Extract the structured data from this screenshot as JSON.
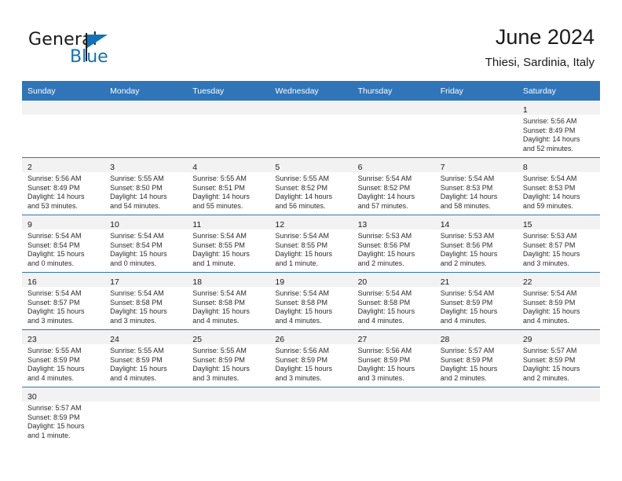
{
  "brand": {
    "name_top": "General",
    "name_bottom": "Blue",
    "flag_color": "#1072bb",
    "icon": "general-blue-logo"
  },
  "header": {
    "title": "June 2024",
    "subtitle": "Thiesi, Sardinia, Italy"
  },
  "theme": {
    "header_blue": "#3075b8",
    "daynum_strip": "#f2f2f2",
    "text": "#1a1a1a",
    "brand_blue": "#1072bb"
  },
  "calendar": {
    "weekday_headers": [
      "Sunday",
      "Monday",
      "Tuesday",
      "Wednesday",
      "Thursday",
      "Friday",
      "Saturday"
    ],
    "weeks": [
      [
        {
          "empty": true
        },
        {
          "empty": true
        },
        {
          "empty": true
        },
        {
          "empty": true
        },
        {
          "empty": true
        },
        {
          "empty": true
        },
        {
          "day": "1",
          "sunrise": "Sunrise: 5:56 AM",
          "sunset": "Sunset: 8:49 PM",
          "daylight1": "Daylight: 14 hours",
          "daylight2": "and 52 minutes."
        }
      ],
      [
        {
          "day": "2",
          "sunrise": "Sunrise: 5:56 AM",
          "sunset": "Sunset: 8:49 PM",
          "daylight1": "Daylight: 14 hours",
          "daylight2": "and 53 minutes."
        },
        {
          "day": "3",
          "sunrise": "Sunrise: 5:55 AM",
          "sunset": "Sunset: 8:50 PM",
          "daylight1": "Daylight: 14 hours",
          "daylight2": "and 54 minutes."
        },
        {
          "day": "4",
          "sunrise": "Sunrise: 5:55 AM",
          "sunset": "Sunset: 8:51 PM",
          "daylight1": "Daylight: 14 hours",
          "daylight2": "and 55 minutes."
        },
        {
          "day": "5",
          "sunrise": "Sunrise: 5:55 AM",
          "sunset": "Sunset: 8:52 PM",
          "daylight1": "Daylight: 14 hours",
          "daylight2": "and 56 minutes."
        },
        {
          "day": "6",
          "sunrise": "Sunrise: 5:54 AM",
          "sunset": "Sunset: 8:52 PM",
          "daylight1": "Daylight: 14 hours",
          "daylight2": "and 57 minutes."
        },
        {
          "day": "7",
          "sunrise": "Sunrise: 5:54 AM",
          "sunset": "Sunset: 8:53 PM",
          "daylight1": "Daylight: 14 hours",
          "daylight2": "and 58 minutes."
        },
        {
          "day": "8",
          "sunrise": "Sunrise: 5:54 AM",
          "sunset": "Sunset: 8:53 PM",
          "daylight1": "Daylight: 14 hours",
          "daylight2": "and 59 minutes."
        }
      ],
      [
        {
          "day": "9",
          "sunrise": "Sunrise: 5:54 AM",
          "sunset": "Sunset: 8:54 PM",
          "daylight1": "Daylight: 15 hours",
          "daylight2": "and 0 minutes."
        },
        {
          "day": "10",
          "sunrise": "Sunrise: 5:54 AM",
          "sunset": "Sunset: 8:54 PM",
          "daylight1": "Daylight: 15 hours",
          "daylight2": "and 0 minutes."
        },
        {
          "day": "11",
          "sunrise": "Sunrise: 5:54 AM",
          "sunset": "Sunset: 8:55 PM",
          "daylight1": "Daylight: 15 hours",
          "daylight2": "and 1 minute."
        },
        {
          "day": "12",
          "sunrise": "Sunrise: 5:54 AM",
          "sunset": "Sunset: 8:55 PM",
          "daylight1": "Daylight: 15 hours",
          "daylight2": "and 1 minute."
        },
        {
          "day": "13",
          "sunrise": "Sunrise: 5:53 AM",
          "sunset": "Sunset: 8:56 PM",
          "daylight1": "Daylight: 15 hours",
          "daylight2": "and 2 minutes."
        },
        {
          "day": "14",
          "sunrise": "Sunrise: 5:53 AM",
          "sunset": "Sunset: 8:56 PM",
          "daylight1": "Daylight: 15 hours",
          "daylight2": "and 2 minutes."
        },
        {
          "day": "15",
          "sunrise": "Sunrise: 5:53 AM",
          "sunset": "Sunset: 8:57 PM",
          "daylight1": "Daylight: 15 hours",
          "daylight2": "and 3 minutes."
        }
      ],
      [
        {
          "day": "16",
          "sunrise": "Sunrise: 5:54 AM",
          "sunset": "Sunset: 8:57 PM",
          "daylight1": "Daylight: 15 hours",
          "daylight2": "and 3 minutes."
        },
        {
          "day": "17",
          "sunrise": "Sunrise: 5:54 AM",
          "sunset": "Sunset: 8:58 PM",
          "daylight1": "Daylight: 15 hours",
          "daylight2": "and 3 minutes."
        },
        {
          "day": "18",
          "sunrise": "Sunrise: 5:54 AM",
          "sunset": "Sunset: 8:58 PM",
          "daylight1": "Daylight: 15 hours",
          "daylight2": "and 4 minutes."
        },
        {
          "day": "19",
          "sunrise": "Sunrise: 5:54 AM",
          "sunset": "Sunset: 8:58 PM",
          "daylight1": "Daylight: 15 hours",
          "daylight2": "and 4 minutes."
        },
        {
          "day": "20",
          "sunrise": "Sunrise: 5:54 AM",
          "sunset": "Sunset: 8:58 PM",
          "daylight1": "Daylight: 15 hours",
          "daylight2": "and 4 minutes."
        },
        {
          "day": "21",
          "sunrise": "Sunrise: 5:54 AM",
          "sunset": "Sunset: 8:59 PM",
          "daylight1": "Daylight: 15 hours",
          "daylight2": "and 4 minutes."
        },
        {
          "day": "22",
          "sunrise": "Sunrise: 5:54 AM",
          "sunset": "Sunset: 8:59 PM",
          "daylight1": "Daylight: 15 hours",
          "daylight2": "and 4 minutes."
        }
      ],
      [
        {
          "day": "23",
          "sunrise": "Sunrise: 5:55 AM",
          "sunset": "Sunset: 8:59 PM",
          "daylight1": "Daylight: 15 hours",
          "daylight2": "and 4 minutes."
        },
        {
          "day": "24",
          "sunrise": "Sunrise: 5:55 AM",
          "sunset": "Sunset: 8:59 PM",
          "daylight1": "Daylight: 15 hours",
          "daylight2": "and 4 minutes."
        },
        {
          "day": "25",
          "sunrise": "Sunrise: 5:55 AM",
          "sunset": "Sunset: 8:59 PM",
          "daylight1": "Daylight: 15 hours",
          "daylight2": "and 3 minutes."
        },
        {
          "day": "26",
          "sunrise": "Sunrise: 5:56 AM",
          "sunset": "Sunset: 8:59 PM",
          "daylight1": "Daylight: 15 hours",
          "daylight2": "and 3 minutes."
        },
        {
          "day": "27",
          "sunrise": "Sunrise: 5:56 AM",
          "sunset": "Sunset: 8:59 PM",
          "daylight1": "Daylight: 15 hours",
          "daylight2": "and 3 minutes."
        },
        {
          "day": "28",
          "sunrise": "Sunrise: 5:57 AM",
          "sunset": "Sunset: 8:59 PM",
          "daylight1": "Daylight: 15 hours",
          "daylight2": "and 2 minutes."
        },
        {
          "day": "29",
          "sunrise": "Sunrise: 5:57 AM",
          "sunset": "Sunset: 8:59 PM",
          "daylight1": "Daylight: 15 hours",
          "daylight2": "and 2 minutes."
        }
      ],
      [
        {
          "day": "30",
          "sunrise": "Sunrise: 5:57 AM",
          "sunset": "Sunset: 8:59 PM",
          "daylight1": "Daylight: 15 hours",
          "daylight2": "and 1 minute."
        },
        {
          "empty": true
        },
        {
          "empty": true
        },
        {
          "empty": true
        },
        {
          "empty": true
        },
        {
          "empty": true
        },
        {
          "empty": true
        }
      ]
    ]
  }
}
